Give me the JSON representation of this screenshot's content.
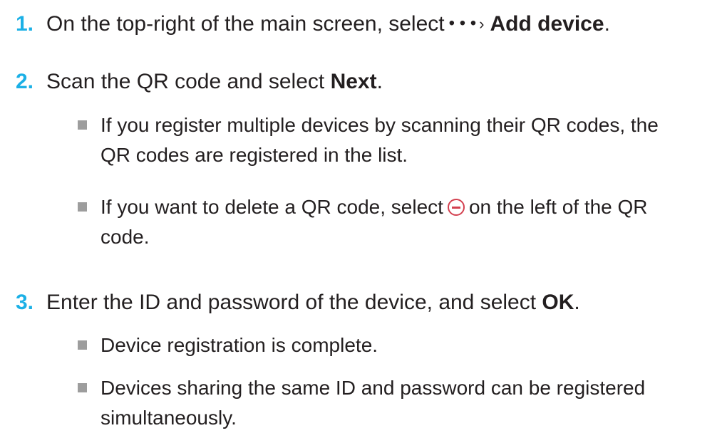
{
  "steps": [
    {
      "number": "1.",
      "text_before": "On the top-right of the main screen, select",
      "icon": "more-dots-icon",
      "icon_glyph": "• • •",
      "chevron": "›",
      "bold": "Add device",
      "text_after": "."
    },
    {
      "number": "2.",
      "text_before": "Scan the QR code and select ",
      "bold": "Next",
      "text_after": ".",
      "notes": [
        {
          "line1": "If you register multiple devices by scanning their QR codes, the",
          "line2": "QR codes are registered in the list."
        },
        {
          "line1_before": "If you want to delete a QR code, select",
          "icon": "minus-circle-icon",
          "line1_after": "on the left of the QR",
          "line2": "code."
        }
      ]
    },
    {
      "number": "3.",
      "text_before": "Enter the ID and password of the device, and select ",
      "bold": "OK",
      "text_after": ".",
      "notes": [
        {
          "line1": "Device registration is complete."
        },
        {
          "line1": "Devices sharing the same ID and password can be registered",
          "line2": "simultaneously."
        }
      ]
    }
  ],
  "colors": {
    "step_number": "#1bb0e6",
    "bullet": "#9d9d9d",
    "minus_icon": "#d3404f"
  }
}
